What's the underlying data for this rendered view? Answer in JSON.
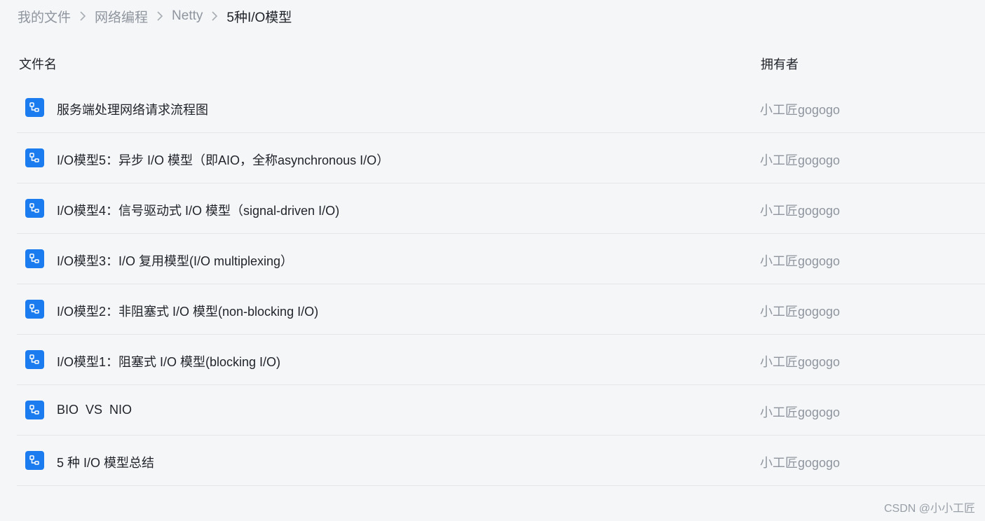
{
  "breadcrumb": {
    "items": [
      "我的文件",
      "网络编程",
      "Netty"
    ],
    "current": "5种I/O模型"
  },
  "table": {
    "headers": {
      "name": "文件名",
      "owner": "拥有者"
    },
    "rows": [
      {
        "name": "服务端处理网络请求流程图",
        "owner": "小工匠gogogo"
      },
      {
        "name": "I/O模型5：异步 I/O 模型（即AIO，全称asynchronous I/O）",
        "owner": "小工匠gogogo"
      },
      {
        "name": "I/O模型4：信号驱动式 I/O 模型（signal-driven I/O)",
        "owner": "小工匠gogogo"
      },
      {
        "name": "I/O模型3：I/O 复用模型(I/O multiplexing）",
        "owner": "小工匠gogogo"
      },
      {
        "name": "I/O模型2：非阻塞式 I/O 模型(non-blocking I/O)",
        "owner": "小工匠gogogo"
      },
      {
        "name": "I/O模型1：阻塞式 I/O 模型(blocking I/O)",
        "owner": "小工匠gogogo"
      },
      {
        "name": "BIO  VS  NIO",
        "owner": "小工匠gogogo"
      },
      {
        "name": "5 种 I/O 模型总结",
        "owner": "小工匠gogogo"
      }
    ]
  },
  "icons": {
    "file": "flowchart-file-icon",
    "separator": "chevron-right-icon"
  },
  "colors": {
    "accent": "#1b7cf0",
    "muted": "#8f959e",
    "background": "#f5f6f8"
  },
  "watermark": "CSDN @小小工匠"
}
